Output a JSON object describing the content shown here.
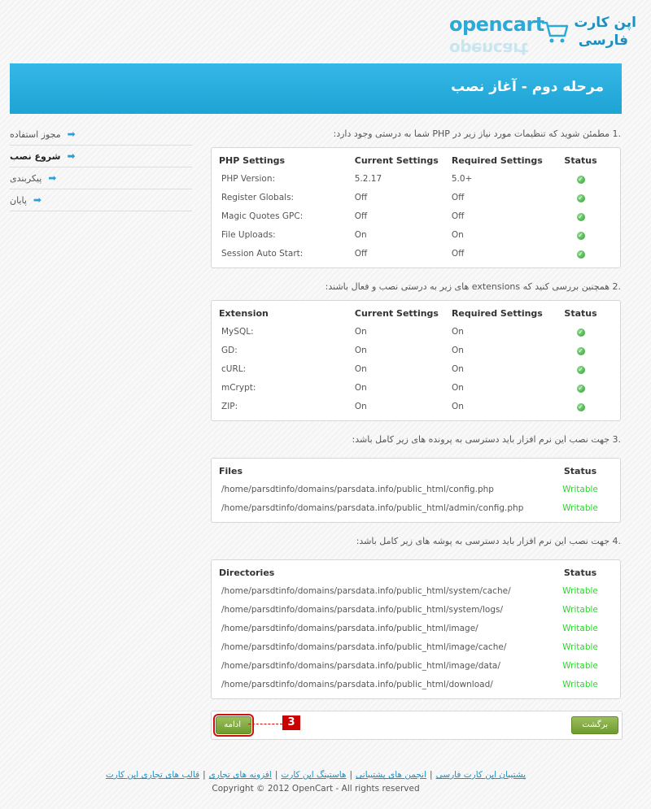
{
  "logo": {
    "brand": "opencart",
    "fa_line1": "اپن کارت",
    "fa_line2": "فارسی",
    "colors": {
      "primary": "#2aaad8",
      "dark": "#1e8fc0"
    }
  },
  "header": {
    "title": "مرحله دوم - آغاز نصب"
  },
  "sidebar": {
    "items": [
      {
        "label": "مجوز استفاده",
        "active": false
      },
      {
        "label": "شروع نصب",
        "active": true
      },
      {
        "label": "پیکربندی",
        "active": false
      },
      {
        "label": "پایان",
        "active": false
      }
    ]
  },
  "sections": {
    "php": {
      "intro": ".1 مطمئن شوید که تنظیمات مورد نیاز زیر در PHP شما به درستی وجود دارد:",
      "headers": [
        "PHP Settings",
        "Current Settings",
        "Required Settings",
        "Status"
      ],
      "rows": [
        {
          "name": "PHP Version:",
          "current": "5.2.17",
          "required": "5.0+",
          "status": "ok"
        },
        {
          "name": "Register Globals:",
          "current": "Off",
          "required": "Off",
          "status": "ok"
        },
        {
          "name": "Magic Quotes GPC:",
          "current": "Off",
          "required": "Off",
          "status": "ok"
        },
        {
          "name": "File Uploads:",
          "current": "On",
          "required": "On",
          "status": "ok"
        },
        {
          "name": "Session Auto Start:",
          "current": "Off",
          "required": "Off",
          "status": "ok"
        }
      ]
    },
    "extensions": {
      "intro": ".2 همچنین بررسی کنید که extensions های زیر به درستی نصب و فعال باشند:",
      "headers": [
        "Extension",
        "Current Settings",
        "Required Settings",
        "Status"
      ],
      "rows": [
        {
          "name": "MySQL:",
          "current": "On",
          "required": "On",
          "status": "ok"
        },
        {
          "name": "GD:",
          "current": "On",
          "required": "On",
          "status": "ok"
        },
        {
          "name": "cURL:",
          "current": "On",
          "required": "On",
          "status": "ok"
        },
        {
          "name": "mCrypt:",
          "current": "On",
          "required": "On",
          "status": "ok"
        },
        {
          "name": "ZIP:",
          "current": "On",
          "required": "On",
          "status": "ok"
        }
      ]
    },
    "files": {
      "intro": ".3 جهت نصب این نرم افزار باید دسترسی به پرونده های زیر کامل باشد:",
      "headers": [
        "Files",
        "Status"
      ],
      "rows": [
        {
          "path": "/home/parsdtinfo/domains/parsdata.info/public_html/config.php",
          "status": "Writable"
        },
        {
          "path": "/home/parsdtinfo/domains/parsdata.info/public_html/admin/config.php",
          "status": "Writable"
        }
      ]
    },
    "directories": {
      "intro": ".4 جهت نصب این نرم افزار باید دسترسی به پوشه های زیر کامل باشد:",
      "headers": [
        "Directories",
        "Status"
      ],
      "rows": [
        {
          "path": "/home/parsdtinfo/domains/parsdata.info/public_html/system/cache/",
          "status": "Writable"
        },
        {
          "path": "/home/parsdtinfo/domains/parsdata.info/public_html/system/logs/",
          "status": "Writable"
        },
        {
          "path": "/home/parsdtinfo/domains/parsdata.info/public_html/image/",
          "status": "Writable"
        },
        {
          "path": "/home/parsdtinfo/domains/parsdata.info/public_html/image/cache/",
          "status": "Writable"
        },
        {
          "path": "/home/parsdtinfo/domains/parsdata.info/public_html/image/data/",
          "status": "Writable"
        },
        {
          "path": "/home/parsdtinfo/domains/parsdata.info/public_html/download/",
          "status": "Writable"
        }
      ]
    }
  },
  "actions": {
    "continue_label": "ادامه",
    "back_label": "برگشت",
    "marker": "3"
  },
  "footer": {
    "links": [
      "پشتیبان اپن کارت فارسی",
      "انجمن های پشتیبانی",
      "هاستینگ اپن کارت",
      "افزونه های تجاری",
      "قالب های تجاری اپن کارت"
    ],
    "separator": "|",
    "copyright": "Copyright © 2012 OpenCart - All rights reserved"
  }
}
